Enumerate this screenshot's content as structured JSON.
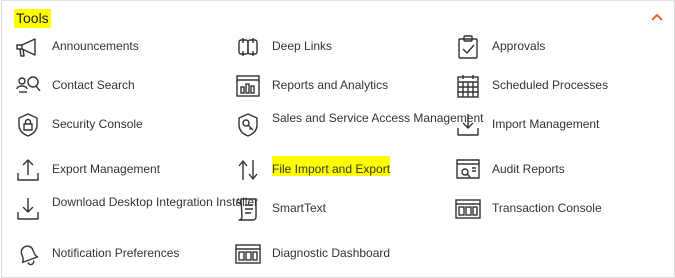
{
  "section": {
    "title": "Tools",
    "accent_color": "#e4652f",
    "highlight_color": "#ffff00"
  },
  "tiles": [
    {
      "label": "Announcements",
      "icon": "megaphone-icon"
    },
    {
      "label": "Deep Links",
      "icon": "link-icon"
    },
    {
      "label": "Approvals",
      "icon": "clipboard-check-icon"
    },
    {
      "label": "Contact Search",
      "icon": "contact-search-icon"
    },
    {
      "label": "Reports and Analytics",
      "icon": "report-chart-icon"
    },
    {
      "label": "Scheduled Processes",
      "icon": "calendar-grid-icon"
    },
    {
      "label": "Security Console",
      "icon": "shield-lock-icon"
    },
    {
      "label": "Sales and Service Access Management",
      "icon": "shield-key-icon"
    },
    {
      "label": "Import Management",
      "icon": "import-tray-icon"
    },
    {
      "label": "Export Management",
      "icon": "export-tray-icon"
    },
    {
      "label": "File Import and Export",
      "icon": "up-down-arrows-icon"
    },
    {
      "label": "Audit Reports",
      "icon": "audit-monitor-icon"
    },
    {
      "label": "Download Desktop Integration Installer",
      "icon": "download-tray-icon"
    },
    {
      "label": "SmartText",
      "icon": "scroll-icon"
    },
    {
      "label": "Transaction Console",
      "icon": "console-icon"
    },
    {
      "label": "Notification Preferences",
      "icon": "bell-icon"
    },
    {
      "label": "Diagnostic Dashboard",
      "icon": "dashboard-icon"
    }
  ]
}
